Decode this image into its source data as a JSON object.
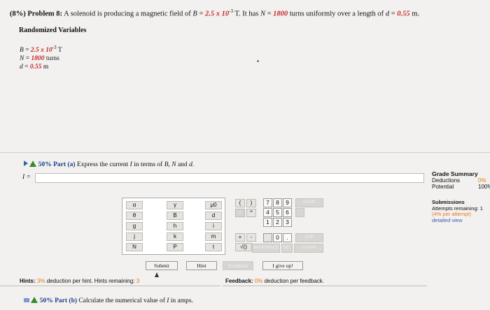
{
  "problem": {
    "prefix": "(8%)",
    "label": "Problem 8:",
    "text_1": "A solenoid is producing a magnetic field of",
    "B_sym": "B",
    "eq": "=",
    "B_value": "2.5 x 10",
    "B_exp": "-3",
    "B_unit": "T. It has",
    "N_sym": "N",
    "N_value": "1800",
    "text_2": "turns uniformly over a length of",
    "d_sym": "d",
    "d_value": "0.55",
    "d_unit": "m."
  },
  "randomized": {
    "title": "Randomized Variables",
    "lines": [
      {
        "sym": "B",
        "eq": " = ",
        "value": "2.5 x 10",
        "exp": "-3",
        "unit": " T"
      },
      {
        "sym": "N",
        "eq": " = ",
        "value": "1800",
        "unit": " turns"
      },
      {
        "sym": "d",
        "eq": " = ",
        "value": "0.55",
        "unit": " m"
      }
    ]
  },
  "part_a": {
    "pct": "50%",
    "part": "Part (a)",
    "text": "Express the current",
    "sym_I": "I",
    "text2": "in terms of",
    "syms": "B, N",
    "and": "and",
    "sym_d": "d.",
    "answer_label": "I =",
    "answer_value": ""
  },
  "grade_summary": {
    "title": "Grade Summary",
    "deductions_label": "Deductions",
    "deductions_value": "0%",
    "potential_label": "Potential",
    "potential_value": "100%"
  },
  "submissions": {
    "title": "Submissions",
    "attempts": "Attempts remaining: 1",
    "per_attempt": "(4% per attempt)",
    "detailed": "detailed view"
  },
  "keypad": {
    "vars": [
      [
        "α",
        "γ",
        "μ0"
      ],
      [
        "θ",
        "B",
        "d"
      ],
      [
        "g",
        "h",
        "i"
      ],
      [
        "j",
        "k",
        "m"
      ],
      [
        "N",
        "P",
        "t"
      ]
    ],
    "ops": [
      "(",
      "↑",
      "+",
      "√()"
    ],
    "ops_r": [
      ")",
      "^",
      "-"
    ],
    "nums": [
      [
        "7",
        "8",
        "9"
      ],
      [
        "4",
        "5",
        "6"
      ],
      [
        "1",
        "2",
        "3"
      ],
      [
        "",
        "0",
        "."
      ]
    ],
    "right_labels": [
      "HOME",
      "",
      "END",
      "CLEAR"
    ],
    "dim_bottom": [
      "BACKSPACE",
      "DEL"
    ]
  },
  "buttons": {
    "submit": "Submit",
    "hint": "Hint",
    "feedback": "Feedback",
    "give_up": "I give up!"
  },
  "hints": {
    "label": "Hints:",
    "pct": "3%",
    "text": "deduction per hint. Hints remaining:",
    "remaining": "3"
  },
  "feedback": {
    "label": "Feedback:",
    "pct": "0%",
    "text": "deduction per feedback."
  },
  "part_b": {
    "pct": "50%",
    "part": "Part (b)",
    "text": "Calculate the numerical value of",
    "sym": "I",
    "text2": "in amps."
  }
}
